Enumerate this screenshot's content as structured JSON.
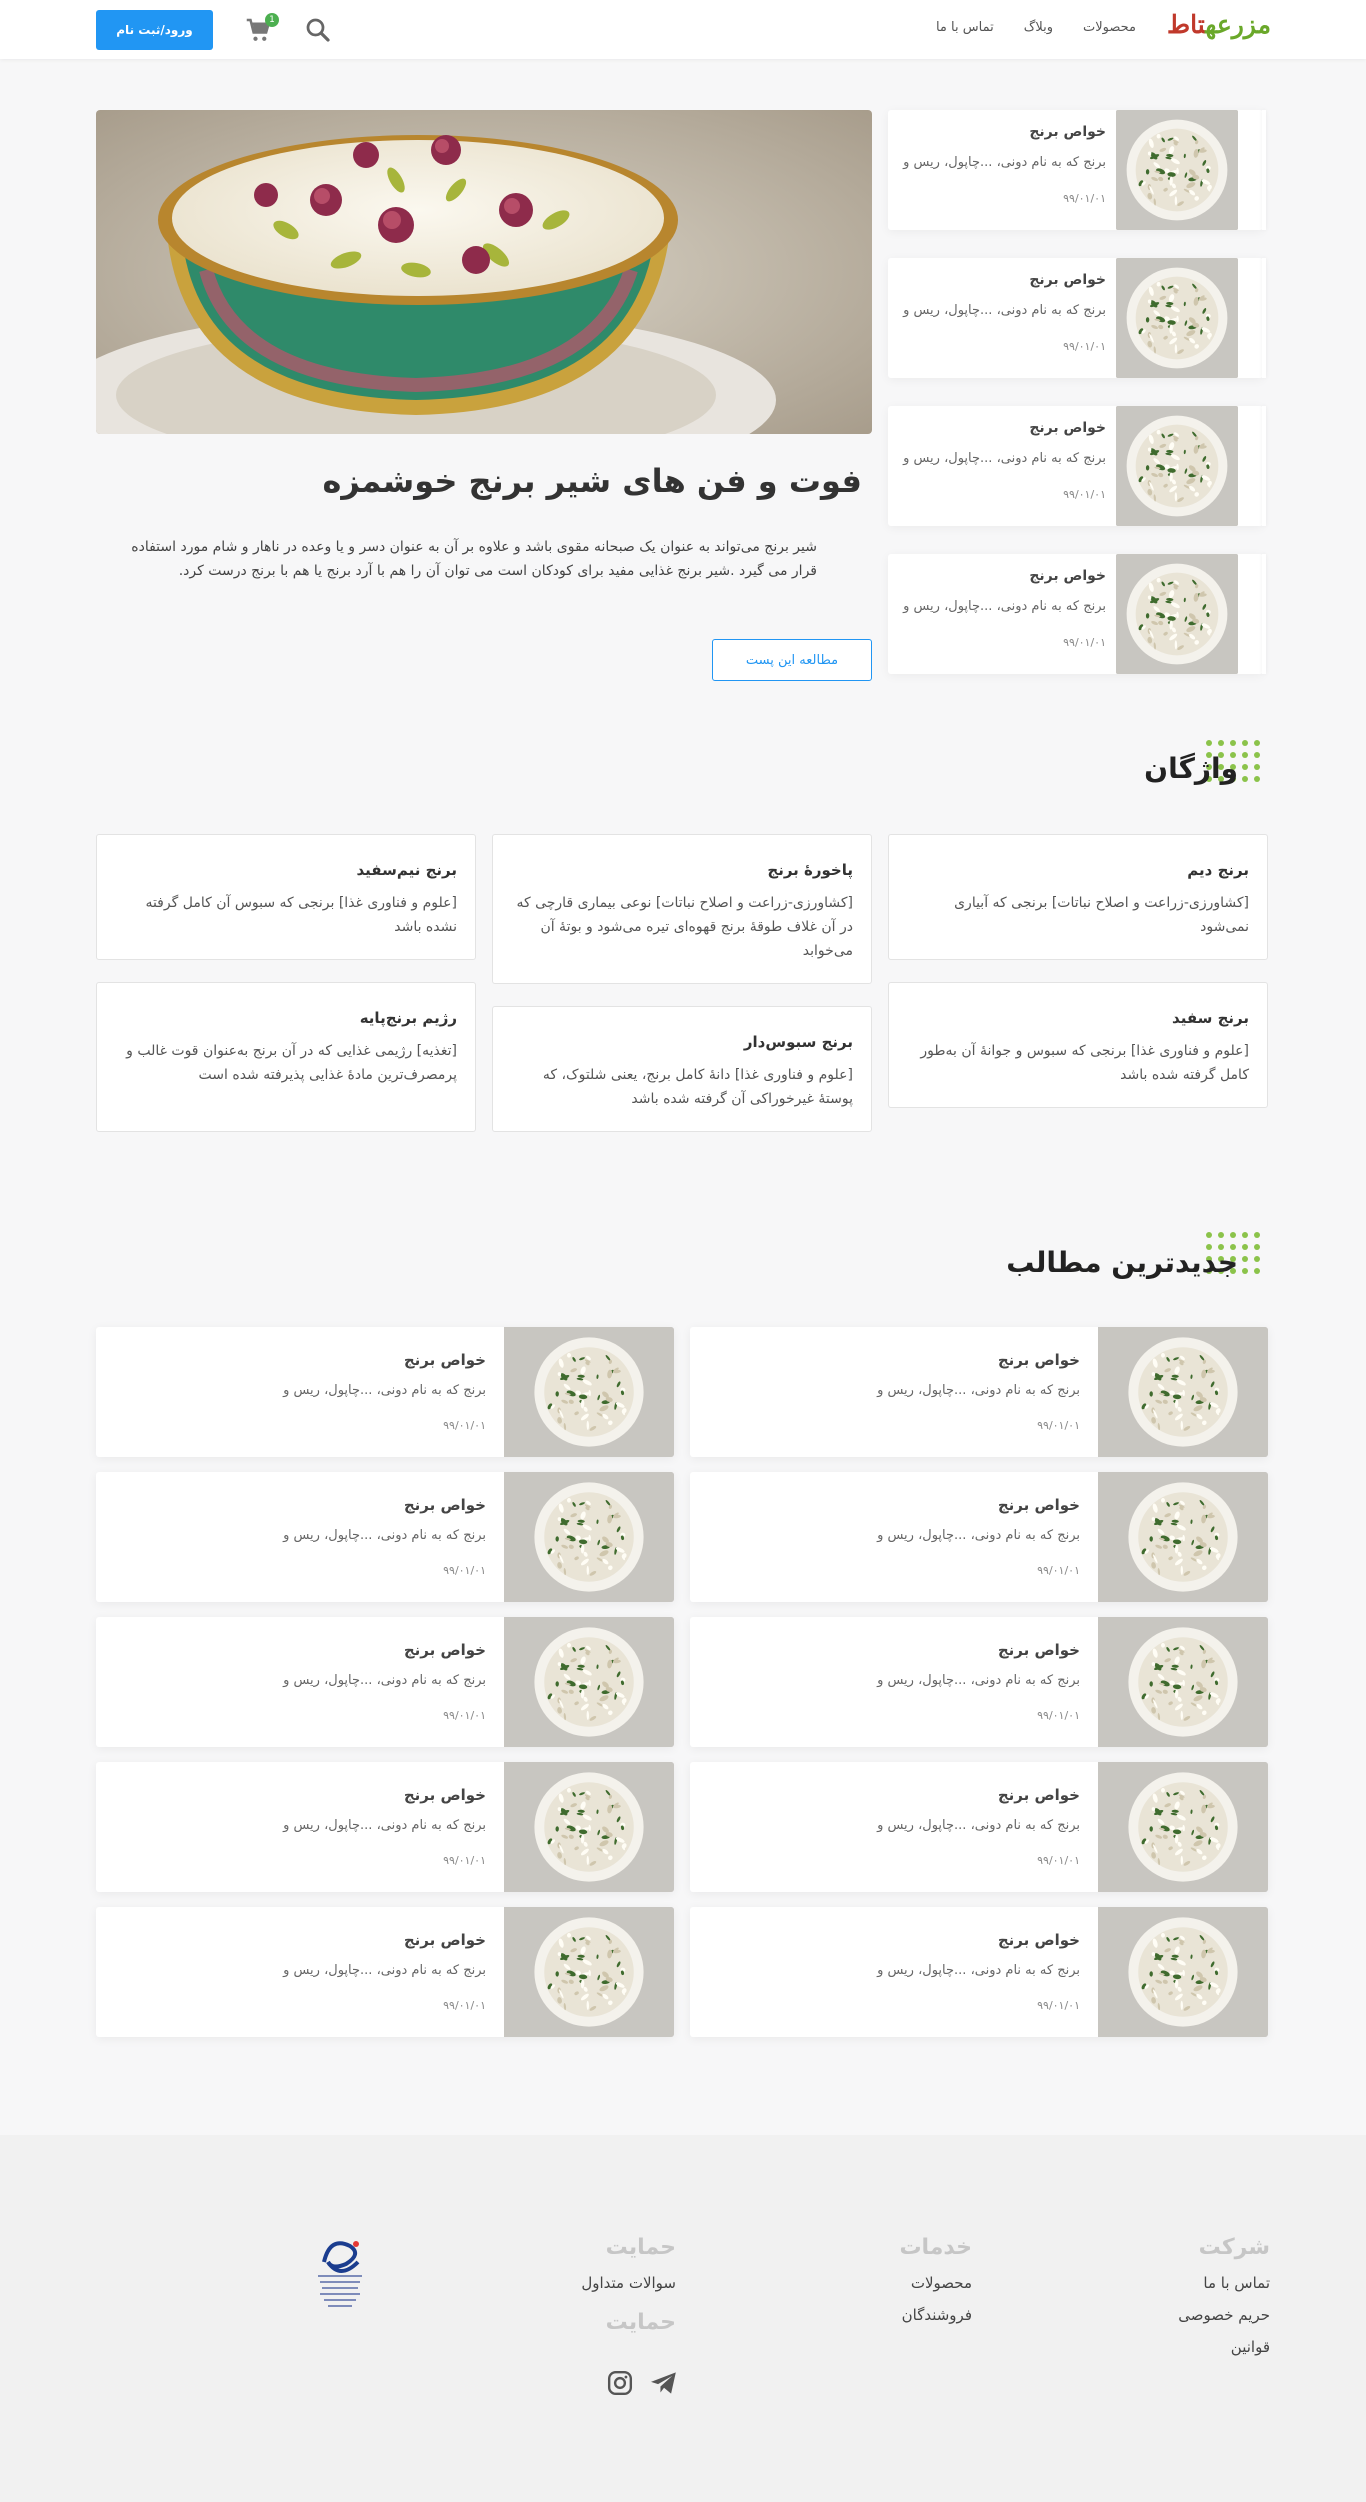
{
  "header": {
    "logo_part1": "مزرعه",
    "logo_part2": "تاط",
    "nav": [
      "محصولات",
      "وبلاگ",
      "تماس با ما"
    ],
    "cart_count": "1",
    "login_label": "ورود/ثبت نام"
  },
  "hero": {
    "title": "فوت و فن های شیر برنج خوشمزه",
    "text": "شیر برنج می‌تواند به عنوان یک صبحانه مقوی باشد و علاوه بر آن به عنوان دسر و یا وعده در ناهار و شام مورد استفاده قرار می گیرد .شیر برنج غذایی مفید برای کودکان است می توان آن را هم با آرد برنج یا هم با برنج درست کرد.",
    "button": "مطالعه این پست"
  },
  "side_posts": [
    {
      "title": "خواص برنج",
      "excerpt": "برنج که به نام دونی، ...چاپول، ریس و",
      "date": "۹۹/۰۱/۰۱"
    },
    {
      "title": "خواص برنج",
      "excerpt": "برنج که به نام دونی، ...چاپول، ریس و",
      "date": "۹۹/۰۱/۰۱"
    },
    {
      "title": "خواص برنج",
      "excerpt": "برنج که به نام دونی، ...چاپول، ریس و",
      "date": "۹۹/۰۱/۰۱"
    },
    {
      "title": "خواص برنج",
      "excerpt": "برنج که به نام دونی، ...چاپول، ریس و",
      "date": "۹۹/۰۱/۰۱"
    }
  ],
  "glossary": {
    "title": "واژگان",
    "items": [
      {
        "term": "برنج دیم",
        "def": "[کشاورزی-زراعت و اصلاح نباتات] برنجی که آبیاری نمی‌شود"
      },
      {
        "term": "پاخورهٔ برنج",
        "def": "[کشاورزی-زراعت و اصلاح نباتات] نوعی بیماری قارچی که در آن غلاف طوقهٔ برنج قهوه‌ای تیره می‌شود و بوتهٔ آن می‌خوابد"
      },
      {
        "term": "برنج نیم‌سفید",
        "def": "[علوم و فناوری غذا] برنجی که سبوس آن کامل گرفته نشده باشد"
      },
      {
        "term": "برنج سفید",
        "def": "[علوم و فناوری غذا] برنجی که سبوس و جوانهٔ آن به‌طور کامل گرفته شده باشد"
      },
      {
        "term": "برنج سبوس‌دار",
        "def": "[علوم و فناوری غذا] دانهٔ کامل برنج، یعنی شلتوک، که پوستهٔ غیرخوراکی آن گرفته شده باشد"
      },
      {
        "term": "رژیم برنج‌پایه",
        "def": "[تغذیه] رژیمی غذایی که در آن برنج به‌عنوان قوت غالب و پرمصرف‌ترین مادهٔ غذایی پذیرفته شده است"
      }
    ]
  },
  "latest": {
    "title": "جدیدترین مطالب",
    "posts": [
      {
        "title": "خواص برنج",
        "excerpt": "برنج که به نام دونی، ...چاپول، ریس و",
        "date": "۹۹/۰۱/۰۱"
      },
      {
        "title": "خواص برنج",
        "excerpt": "برنج که به نام دونی، ...چاپول، ریس و",
        "date": "۹۹/۰۱/۰۱"
      },
      {
        "title": "خواص برنج",
        "excerpt": "برنج که به نام دونی، ...چاپول، ریس و",
        "date": "۹۹/۰۱/۰۱"
      },
      {
        "title": "خواص برنج",
        "excerpt": "برنج که به نام دونی، ...چاپول، ریس و",
        "date": "۹۹/۰۱/۰۱"
      },
      {
        "title": "خواص برنج",
        "excerpt": "برنج که به نام دونی، ...چاپول، ریس و",
        "date": "۹۹/۰۱/۰۱"
      },
      {
        "title": "خواص برنج",
        "excerpt": "برنج که به نام دونی، ...چاپول، ریس و",
        "date": "۹۹/۰۱/۰۱"
      },
      {
        "title": "خواص برنج",
        "excerpt": "برنج که به نام دونی، ...چاپول، ریس و",
        "date": "۹۹/۰۱/۰۱"
      },
      {
        "title": "خواص برنج",
        "excerpt": "برنج که به نام دونی، ...چاپول، ریس و",
        "date": "۹۹/۰۱/۰۱"
      },
      {
        "title": "خواص برنج",
        "excerpt": "برنج که به نام دونی، ...چاپول، ریس و",
        "date": "۹۹/۰۱/۰۱"
      },
      {
        "title": "خواص برنج",
        "excerpt": "برنج که به نام دونی، ...چاپول، ریس و",
        "date": "۹۹/۰۱/۰۱"
      }
    ]
  },
  "footer": {
    "company": {
      "title": "شرکت",
      "links": [
        "تماس با ما",
        "حریم خصوصی",
        "قوانین"
      ]
    },
    "services": {
      "title": "خدمات",
      "links": [
        "محصولات",
        "فروشندگان"
      ]
    },
    "support": {
      "title": "حمایت",
      "links": [
        "سوالات متداول"
      ]
    },
    "social_title": "حمایت",
    "social_icons": [
      "instagram-icon",
      "telegram-icon"
    ]
  },
  "colors": {
    "primary": "#2196f3",
    "accent_green": "#8bc34a",
    "logo_green": "#6aa82a"
  }
}
